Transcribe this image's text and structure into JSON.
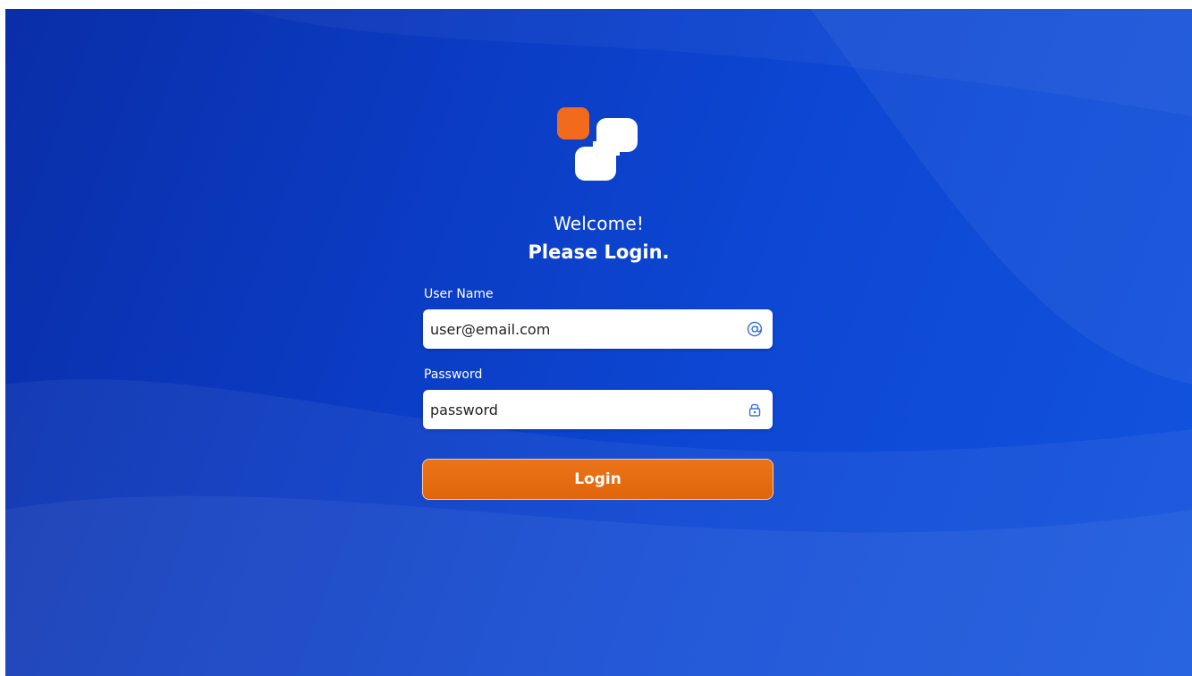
{
  "greeting": {
    "welcome": "Welcome!",
    "prompt": "Please Login."
  },
  "form": {
    "username": {
      "label": "User Name",
      "value": "user@email.com",
      "icon": "at-sign-icon"
    },
    "password": {
      "label": "Password",
      "value": "password",
      "icon": "lock-icon"
    },
    "submit_label": "Login"
  },
  "colors": {
    "background": "#0b3cc4",
    "accent": "#e86c12",
    "logo_accent": "#f26a1b",
    "input_icon": "#3b6fd8"
  }
}
